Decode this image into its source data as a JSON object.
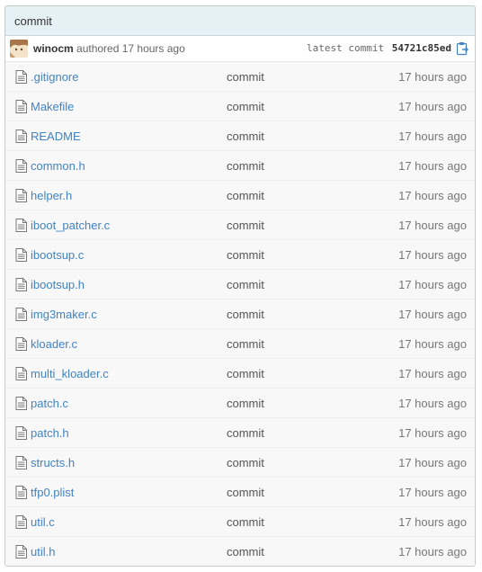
{
  "commit": {
    "message": "commit",
    "author": "winocm",
    "authored_text": "authored 17 hours ago",
    "latest_label": "latest commit",
    "sha": "54721c85ed"
  },
  "icons": {
    "avatar": "user-avatar",
    "copy": "clipboard-icon",
    "file": "file-text-icon"
  },
  "colors": {
    "link": "#4183c4",
    "header_bg": "#e6f1f6",
    "row_bg": "#f8f8f8"
  },
  "files": [
    {
      "name": ".gitignore",
      "message": "commit",
      "age": "17 hours ago"
    },
    {
      "name": "Makefile",
      "message": "commit",
      "age": "17 hours ago"
    },
    {
      "name": "README",
      "message": "commit",
      "age": "17 hours ago"
    },
    {
      "name": "common.h",
      "message": "commit",
      "age": "17 hours ago"
    },
    {
      "name": "helper.h",
      "message": "commit",
      "age": "17 hours ago"
    },
    {
      "name": "iboot_patcher.c",
      "message": "commit",
      "age": "17 hours ago"
    },
    {
      "name": "ibootsup.c",
      "message": "commit",
      "age": "17 hours ago"
    },
    {
      "name": "ibootsup.h",
      "message": "commit",
      "age": "17 hours ago"
    },
    {
      "name": "img3maker.c",
      "message": "commit",
      "age": "17 hours ago"
    },
    {
      "name": "kloader.c",
      "message": "commit",
      "age": "17 hours ago"
    },
    {
      "name": "multi_kloader.c",
      "message": "commit",
      "age": "17 hours ago"
    },
    {
      "name": "patch.c",
      "message": "commit",
      "age": "17 hours ago"
    },
    {
      "name": "patch.h",
      "message": "commit",
      "age": "17 hours ago"
    },
    {
      "name": "structs.h",
      "message": "commit",
      "age": "17 hours ago"
    },
    {
      "name": "tfp0.plist",
      "message": "commit",
      "age": "17 hours ago"
    },
    {
      "name": "util.c",
      "message": "commit",
      "age": "17 hours ago"
    },
    {
      "name": "util.h",
      "message": "commit",
      "age": "17 hours ago"
    }
  ]
}
